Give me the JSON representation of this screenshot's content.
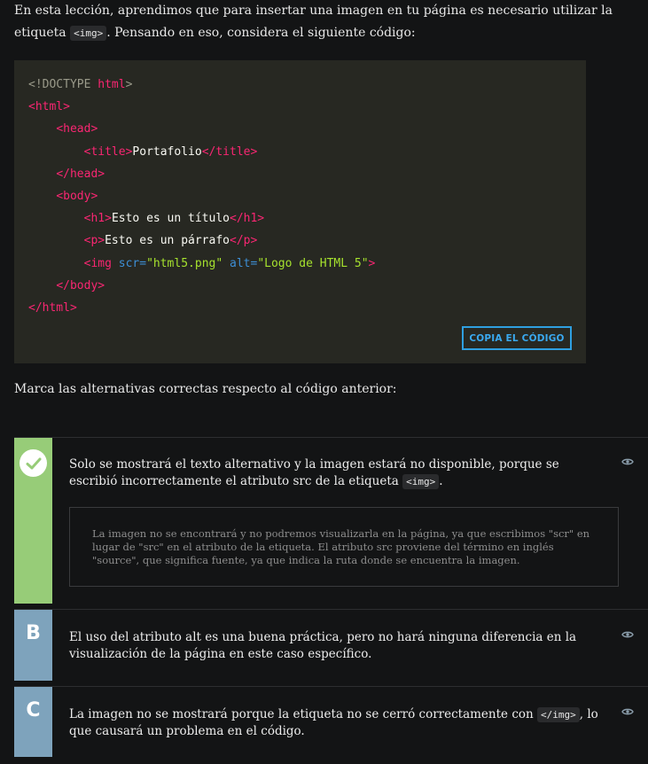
{
  "intro": {
    "text_before": "En esta lección, aprendimos que para insertar una imagen en tu página es necesario utilizar la etiqueta",
    "code": "<img>",
    "text_after": ". Pensando en eso, considera el siguiente código:"
  },
  "code_block": {
    "doctype_open": "<!DOCTYPE ",
    "doctype_html": "html",
    "doctype_close": ">",
    "html_open": "<html>",
    "head_open": "<head>",
    "title_open": "<title>",
    "title_text": "Portafolio",
    "title_close": "</title>",
    "head_close": "</head>",
    "body_open": "<body>",
    "h1_open": "<h1>",
    "h1_text": "Esto es un título",
    "h1_close": "</h1>",
    "p_open": "<p>",
    "p_text": "Esto es un párrafo",
    "p_close": "</p>",
    "img_open": "<img ",
    "scr_attr": "scr=",
    "scr_val": "\"html5.png\"",
    "alt_attr": "alt=",
    "alt_val": "\"Logo de HTML 5\"",
    "img_close": ">",
    "body_close": "</body>",
    "html_close": "</html>",
    "copy_label": "COPIA EL CÓDIGO"
  },
  "question": "Marca las alternativas correctas respecto al código anterior:",
  "options": [
    {
      "state": "correct",
      "text_before": "Solo se mostrará el texto alternativo y la imagen estará no disponible, porque se escribió incorrectamente el atributo src de la etiqueta",
      "code": "<img>",
      "text_after": ".",
      "explanation": "La imagen no se encontrará y no podremos visualizarla en la página, ya que escribimos \"scr\" en lugar de \"src\" en el atributo de la etiqueta. El atributo src proviene del término en inglés \"source\", que significa fuente, ya que indica la ruta donde se encuentra la imagen."
    },
    {
      "letter": "B",
      "text": "El uso del atributo alt es una buena práctica, pero no hará ninguna diferencia en la visualización de la página en este caso específico."
    },
    {
      "letter": "C",
      "text_before": "La imagen no se mostrará porque la etiqueta no se cerró correctamente con",
      "code": "</img>",
      "text_after": ", lo que causará un problema en el código."
    }
  ],
  "colors": {
    "correct": "#97cc78",
    "neutral": "#7ea3bc",
    "accent": "#2f9fe0",
    "background": "#131415",
    "code_bg": "#272822"
  },
  "icons": {
    "check": "check-icon",
    "eye": "eye-icon"
  }
}
